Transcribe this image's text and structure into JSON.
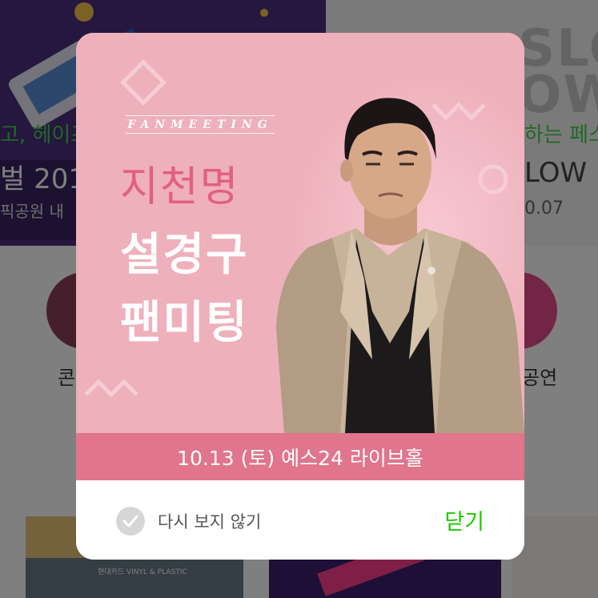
{
  "background": {
    "banner_left": {
      "line1": "고, 헤이즈",
      "title": "벌 201",
      "subtitle": "픽공원 내"
    },
    "banner_right": {
      "big_text_1": "SLOV",
      "big_text_2": "OWF",
      "line1": "하는 페스",
      "title": "LOW",
      "subtitle": "0.07"
    },
    "categories": {
      "left_label": "콘",
      "right_label": "공연"
    },
    "thumbnail_text": "현대카드 VINYL & PLASTIC"
  },
  "modal": {
    "fanmeeting_label": "FANMEETING",
    "title_line1": "지천명",
    "title_line2": "설경구",
    "title_line3": "팬미팅",
    "date_venue": "10.13 (토) 예스24 라이브홀",
    "dont_show_label": "다시 보지 않기",
    "close_label": "닫기"
  },
  "colors": {
    "poster_pink": "#eeb0bb",
    "title_accent": "#e2607f",
    "date_band": "#e0758c",
    "close_green": "#1ec800"
  },
  "icons": {
    "checkbox": "check-icon"
  }
}
